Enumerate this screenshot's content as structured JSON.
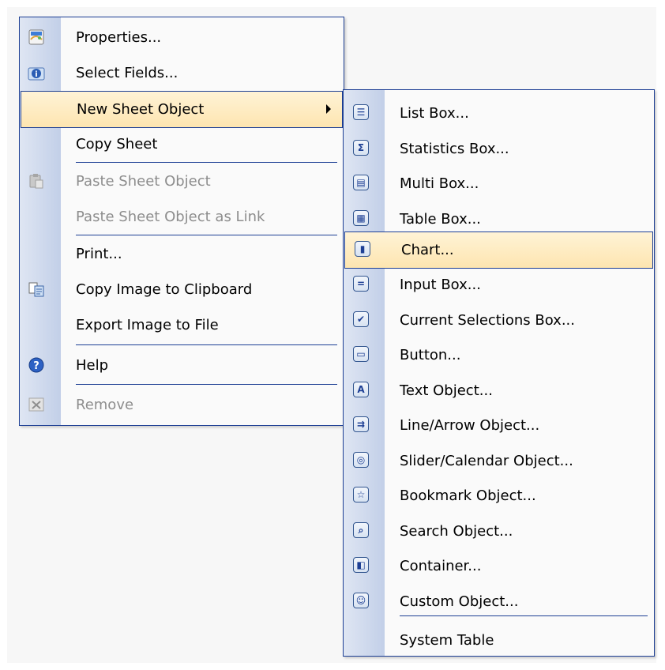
{
  "main_menu": {
    "items": [
      {
        "label": "Properties...",
        "icon": "properties-icon",
        "disabled": false
      },
      {
        "label": "Select Fields...",
        "icon": "select-fields-icon",
        "disabled": false
      },
      {
        "label": "New Sheet Object",
        "icon": "",
        "disabled": false,
        "submenu": true,
        "highlighted": true
      },
      {
        "label": "Copy Sheet",
        "icon": "",
        "disabled": false
      },
      {
        "label": "Paste Sheet Object",
        "icon": "paste-icon",
        "disabled": true
      },
      {
        "label": "Paste Sheet Object as Link",
        "icon": "",
        "disabled": true
      },
      {
        "label": "Print...",
        "icon": "",
        "disabled": false
      },
      {
        "label": "Copy Image to Clipboard",
        "icon": "copy-image-icon",
        "disabled": false
      },
      {
        "label": "Export Image to File",
        "icon": "",
        "disabled": false
      },
      {
        "label": "Help",
        "icon": "help-icon",
        "disabled": false
      },
      {
        "label": "Remove",
        "icon": "remove-icon",
        "disabled": true
      }
    ]
  },
  "sub_menu": {
    "items": [
      {
        "label": "List Box...",
        "icon": "list-box-icon",
        "glyph": "☰"
      },
      {
        "label": "Statistics Box...",
        "icon": "statistics-box-icon",
        "glyph": "Σ"
      },
      {
        "label": "Multi Box...",
        "icon": "multi-box-icon",
        "glyph": "▤"
      },
      {
        "label": "Table Box...",
        "icon": "table-box-icon",
        "glyph": "▦"
      },
      {
        "label": "Chart...",
        "icon": "chart-icon",
        "glyph": "▮",
        "highlighted": true
      },
      {
        "label": "Input Box...",
        "icon": "input-box-icon",
        "glyph": "="
      },
      {
        "label": "Current Selections Box...",
        "icon": "current-selections-icon",
        "glyph": "✔"
      },
      {
        "label": "Button...",
        "icon": "button-icon",
        "glyph": "▭"
      },
      {
        "label": "Text Object...",
        "icon": "text-object-icon",
        "glyph": "A"
      },
      {
        "label": "Line/Arrow Object...",
        "icon": "line-arrow-icon",
        "glyph": "⇉"
      },
      {
        "label": "Slider/Calendar Object...",
        "icon": "slider-calendar-icon",
        "glyph": "◎"
      },
      {
        "label": "Bookmark Object...",
        "icon": "bookmark-icon",
        "glyph": "☆"
      },
      {
        "label": "Search Object...",
        "icon": "search-icon",
        "glyph": "⌕"
      },
      {
        "label": "Container...",
        "icon": "container-icon",
        "glyph": "◧"
      },
      {
        "label": "Custom Object...",
        "icon": "custom-object-icon",
        "glyph": "☺"
      },
      {
        "label": "System Table",
        "icon": "",
        "glyph": ""
      }
    ]
  }
}
